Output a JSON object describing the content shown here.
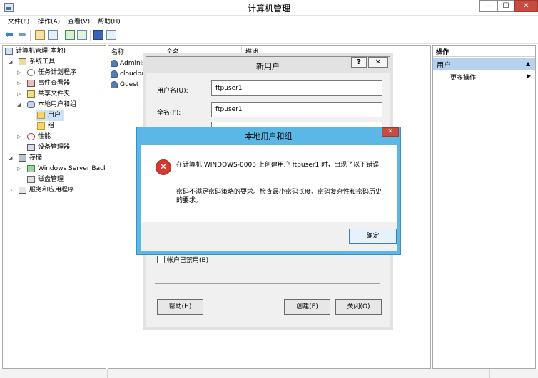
{
  "window": {
    "title": "计算机管理",
    "min": "—",
    "max": "☐",
    "close": "✕"
  },
  "menu": [
    "文件(F)",
    "操作(A)",
    "查看(V)",
    "帮助(H)"
  ],
  "toolbar": {
    "back": "⬅",
    "forward": "➡"
  },
  "tree": {
    "items": [
      "计算机管理(本地)",
      "系统工具",
      "任务计划程序",
      "事件查看器",
      "共享文件夹",
      "本地用户和组",
      "用户",
      "组",
      "性能",
      "设备管理器",
      "存储",
      "Windows Server Back",
      "磁盘管理",
      "服务和应用程序"
    ]
  },
  "list": {
    "columns": [
      "名称",
      "全名",
      "描述"
    ],
    "users": [
      "Administ",
      "cloudba",
      "Guest"
    ]
  },
  "actions": {
    "header": "操作",
    "section": "用户",
    "more": "更多操作"
  },
  "new_user": {
    "title": "新用户",
    "help": "?",
    "close": "✕",
    "username_label": "用户名(U):",
    "username_value": "ftpuser1",
    "fullname_label": "全名(F):",
    "fullname_value": "ftpuser1",
    "disabled_label": "帐户已禁用(B)",
    "help_button": "帮助(H)",
    "create_button": "创建(E)",
    "close_button": "关闭(O)"
  },
  "error": {
    "title": "本地用户和组",
    "close": "✕",
    "icon": "✕",
    "message1": "在计算机 WINDOWS-0003 上创建用户 ftpuser1 时，出现了以下错误:",
    "message2": "密码不满足密码策略的要求。检查最小密码长度、密码复杂性和密码历史的要求。",
    "ok": "确定"
  }
}
